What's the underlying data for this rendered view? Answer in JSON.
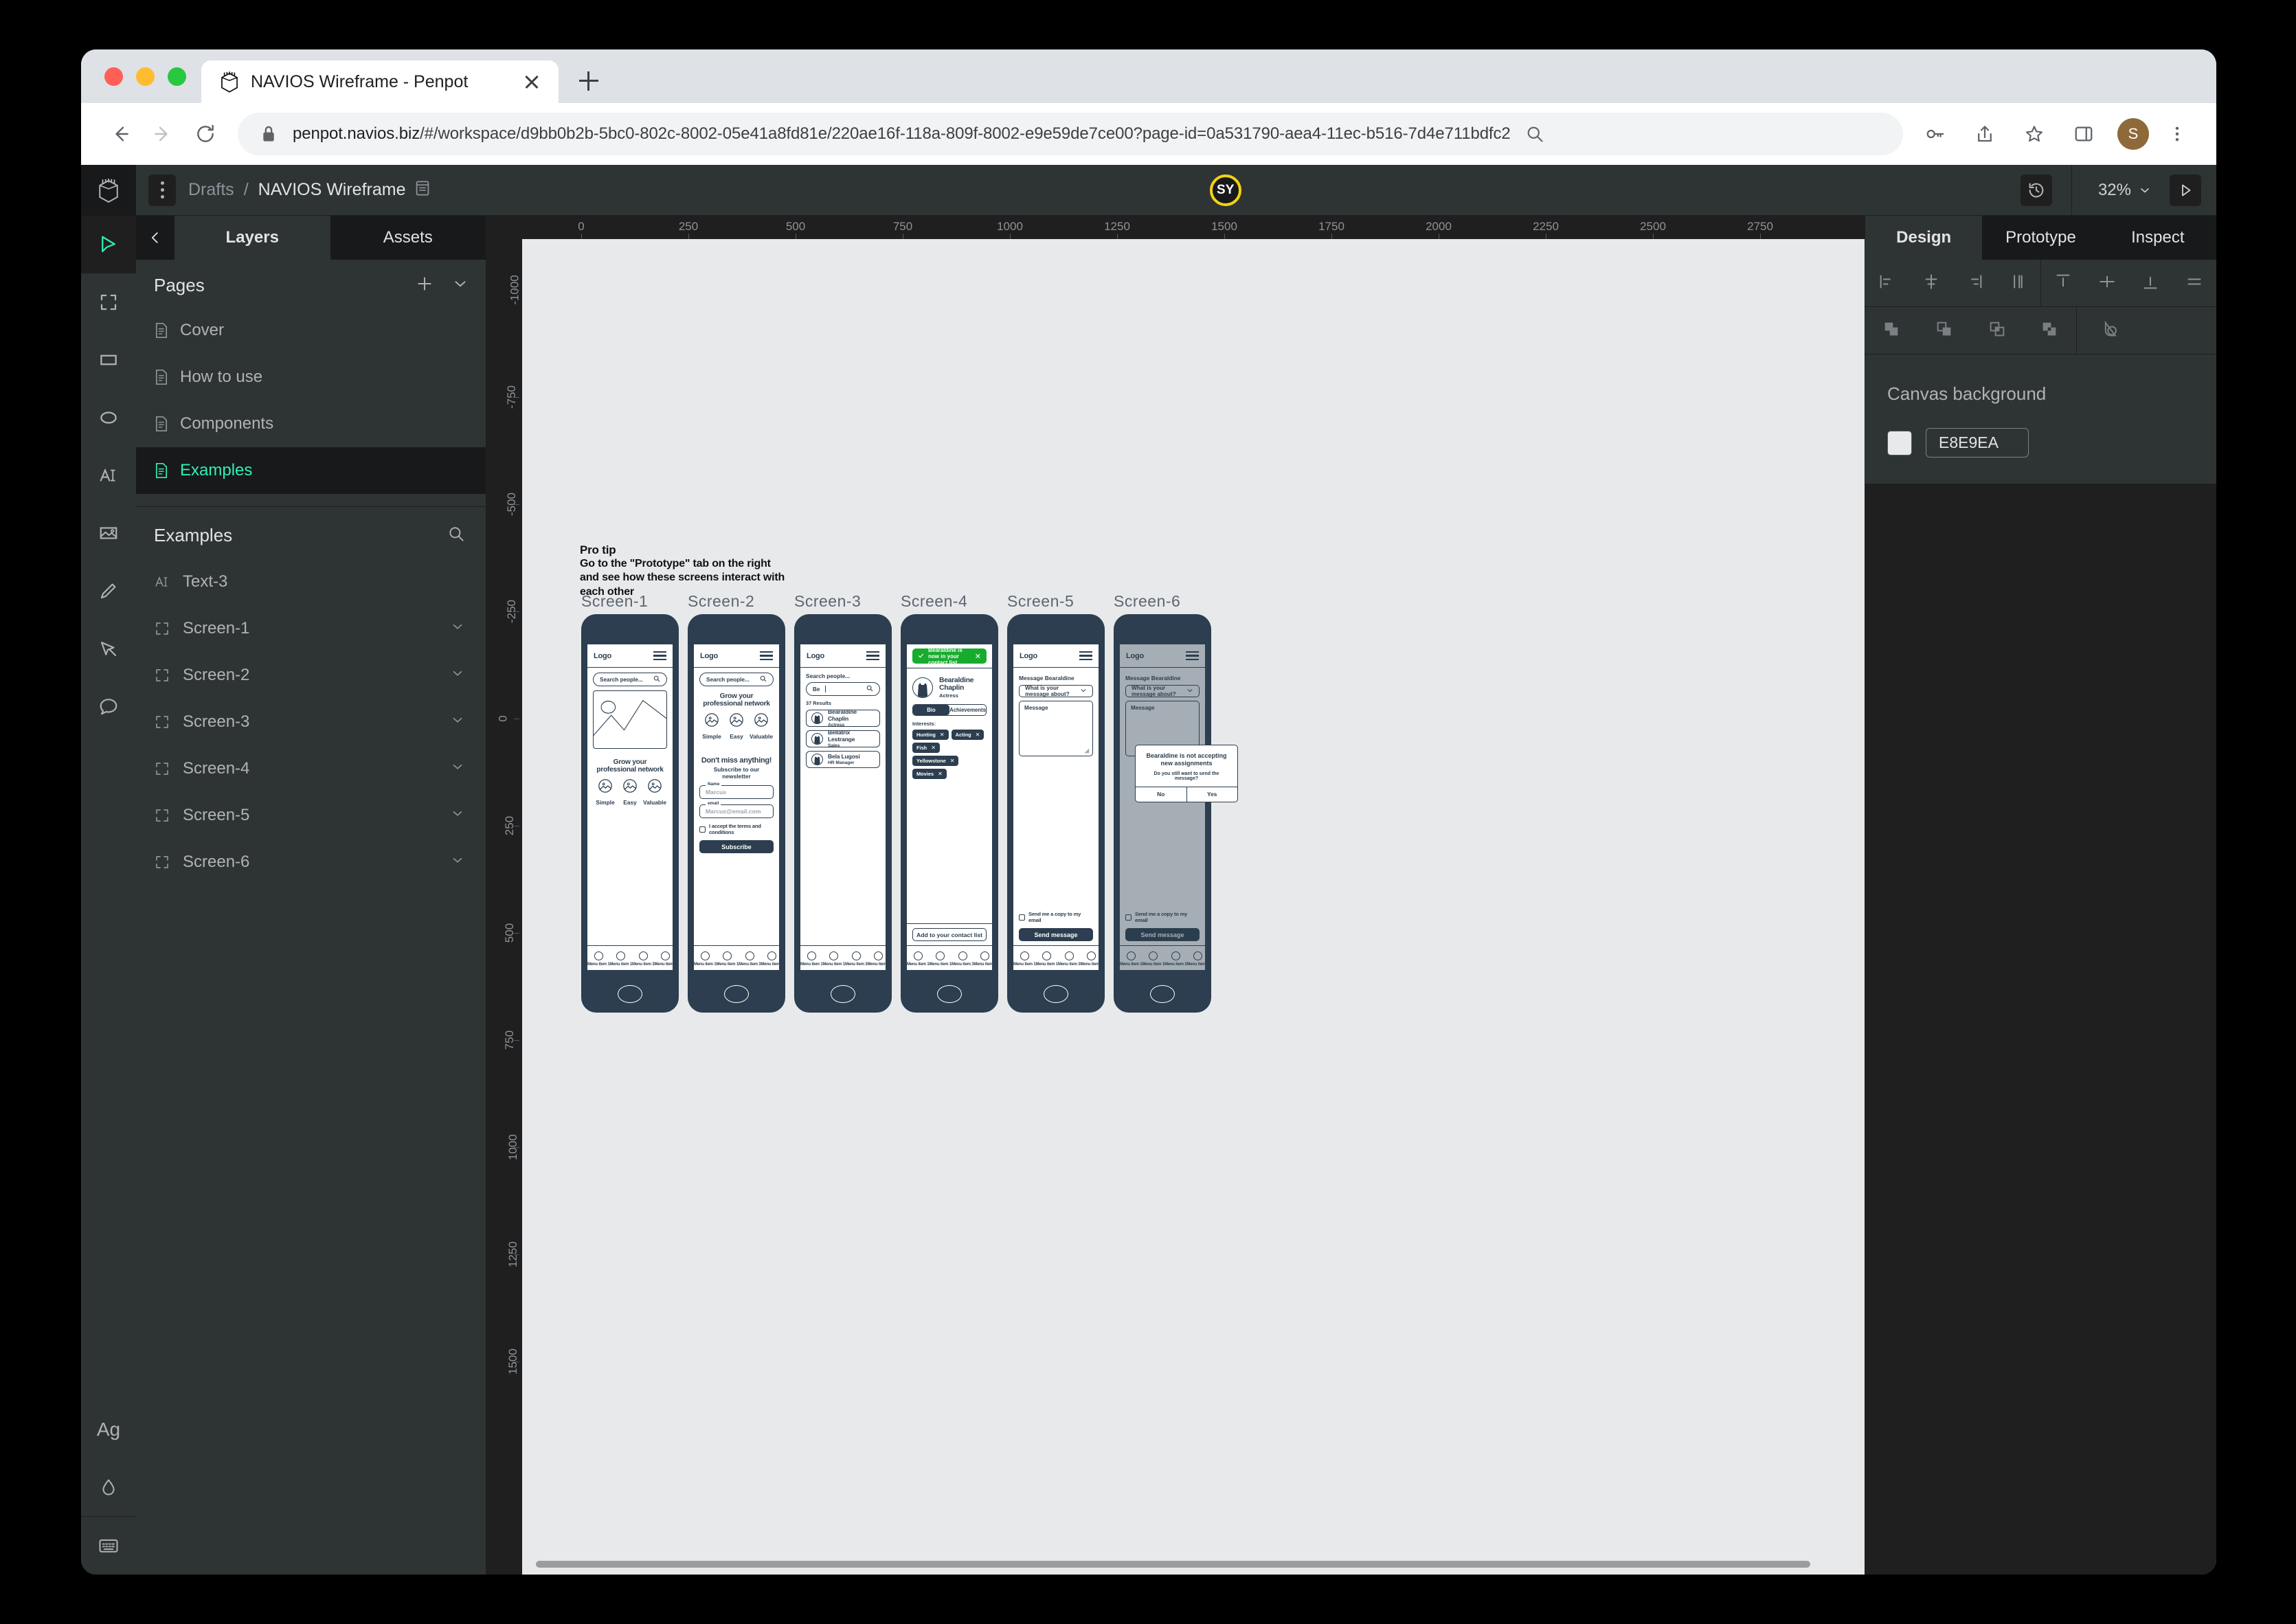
{
  "browser": {
    "tab": {
      "title": "NAVIOS Wireframe - Penpot",
      "favicon": "penpot-logo-icon"
    },
    "new_tab_label": "+",
    "url_host": "penpot.navios.biz",
    "url_path": "/#/workspace/d9bb0b2b-5bc0-802c-8002-05e41a8fd81e/220ae16f-118a-809f-8002-e9e59de7ce00?page-id=0a531790-aea4-11ec-b516-7d4e711bdfc2",
    "profile_initial": "S"
  },
  "app": {
    "breadcrumb": {
      "project": "Drafts",
      "separator": "/",
      "file": "NAVIOS Wireframe"
    },
    "collaborator_initials": "SY",
    "zoom_level": "32%",
    "toolbar": [
      {
        "name": "pointer-tool",
        "active": true
      },
      {
        "name": "board-tool",
        "active": false
      },
      {
        "name": "rectangle-tool",
        "active": false
      },
      {
        "name": "ellipse-tool",
        "active": false
      },
      {
        "name": "text-tool",
        "active": false
      },
      {
        "name": "image-tool",
        "active": false
      },
      {
        "name": "pencil-tool",
        "active": false
      },
      {
        "name": "path-tool",
        "active": false
      },
      {
        "name": "comment-tool",
        "active": false
      }
    ],
    "toolbar_bottom": [
      {
        "name": "typography-tool",
        "label": "Ag"
      },
      {
        "name": "color-palette-tool",
        "label": ""
      },
      {
        "name": "shortcuts-tool",
        "label": ""
      }
    ]
  },
  "left_panel": {
    "tabs": [
      {
        "label": "Layers",
        "active": true
      },
      {
        "label": "Assets",
        "active": false
      }
    ],
    "pages_title": "Pages",
    "pages": [
      {
        "label": "Cover",
        "selected": false
      },
      {
        "label": "How to use",
        "selected": false
      },
      {
        "label": "Components",
        "selected": false
      },
      {
        "label": "Examples",
        "selected": true
      }
    ],
    "layers_title": "Examples",
    "layers": [
      {
        "label": "Text-3",
        "icon": "text-icon",
        "expandable": false
      },
      {
        "label": "Screen-1",
        "icon": "board-icon",
        "expandable": true
      },
      {
        "label": "Screen-2",
        "icon": "board-icon",
        "expandable": true
      },
      {
        "label": "Screen-3",
        "icon": "board-icon",
        "expandable": true
      },
      {
        "label": "Screen-4",
        "icon": "board-icon",
        "expandable": true
      },
      {
        "label": "Screen-5",
        "icon": "board-icon",
        "expandable": true
      },
      {
        "label": "Screen-6",
        "icon": "board-icon",
        "expandable": true
      }
    ]
  },
  "right_panel": {
    "tabs": [
      {
        "label": "Design",
        "active": true
      },
      {
        "label": "Prototype",
        "active": false
      },
      {
        "label": "Inspect",
        "active": false
      }
    ],
    "canvas_background_label": "Canvas background",
    "canvas_background_hex": "E8E9EA"
  },
  "rulers": {
    "horizontal": [
      "0",
      "250",
      "500",
      "750",
      "1000",
      "1250",
      "1500",
      "1750",
      "2000",
      "2250",
      "2500",
      "2750"
    ],
    "vertical": [
      "-1000",
      "-750",
      "-500",
      "-250",
      "0",
      "250",
      "500",
      "750",
      "1000",
      "1250",
      "1500"
    ]
  },
  "canvas": {
    "pro_tip": {
      "title": "Pro tip",
      "body": "Go to the \"Prototype\" tab on the right and see how these screens interact with each other"
    },
    "screen_labels": [
      "Screen-1",
      "Screen-2",
      "Screen-3",
      "Screen-4",
      "Screen-5",
      "Screen-6"
    ],
    "common": {
      "logo": "Logo",
      "search_placeholder": "Search people...",
      "headline": "Grow your professional network",
      "features": [
        "Simple",
        "Easy",
        "Valuable"
      ],
      "nav": [
        "Menu item 1",
        "Menu item 1",
        "Menu item 3",
        "Menu item 4"
      ]
    },
    "screen2": {
      "newsletter_title": "Don't miss anything!",
      "newsletter_sub": "Subscribe to our newsletter",
      "name_legend": "Name",
      "name_placeholder": "Marcus",
      "email_legend": "email",
      "email_placeholder": "Marcus@email.com",
      "terms_label": "I accept the terms and conditions",
      "subscribe_label": "Subscribe"
    },
    "screen3": {
      "search_label": "Search people...",
      "query": "Be",
      "results_count": "37 Results",
      "results": [
        {
          "name": "Bearaldine Chaplin",
          "role": "Actress"
        },
        {
          "name": "Bellatrix Lestrange",
          "role": "Sales"
        },
        {
          "name": "Bela Lugosi",
          "role": "HR Manager"
        }
      ]
    },
    "screen4": {
      "toast": "Bearaldine is now in your contact list",
      "profile_name": "Bearaldine Chaplin",
      "profile_role": "Actress",
      "tabs": [
        {
          "label": "Bio",
          "active": true
        },
        {
          "label": "Achievements",
          "active": false
        }
      ],
      "interests_label": "Interests:",
      "interests": [
        "Hunting",
        "Acting",
        "Fish",
        "Yellowstone",
        "Movies"
      ],
      "add_contact_label": "Add to your contact list"
    },
    "screen5": {
      "title": "Message Bearaldine",
      "select_value": "What is your message about?",
      "message_placeholder": "Message",
      "copy_label": "Send me a copy to my email",
      "send_label": "Send message"
    },
    "screen6": {
      "title": "Message Bearaldine",
      "select_value": "What is your message about?",
      "message_placeholder": "Message",
      "copy_label": "Send me a copy to my email",
      "send_label": "Send message",
      "modal_title": "Bearaldine is not accepting new assignments",
      "modal_sub": "Do you still want to send the message?",
      "modal_no": "No",
      "modal_yes": "Yes"
    }
  }
}
